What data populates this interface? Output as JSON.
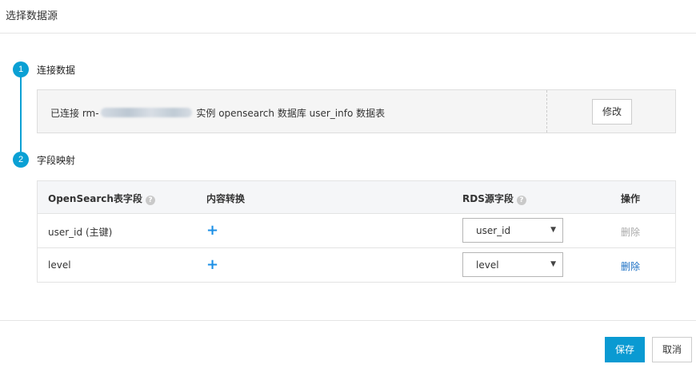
{
  "dialog": {
    "title": "选择数据源"
  },
  "steps": [
    {
      "number": "1",
      "label": "连接数据"
    },
    {
      "number": "2",
      "label": "字段映射"
    }
  ],
  "connection": {
    "text_before": "已连接 rm-",
    "text_after": " 实例 opensearch 数据库 user_info 数据表",
    "modify_label": "修改"
  },
  "mapping_table": {
    "headers": {
      "opensearch_field": "OpenSearch表字段",
      "content_transform": "内容转换",
      "rds_field": "RDS源字段",
      "actions": "操作"
    },
    "help_icon": "?",
    "rows": [
      {
        "field": "user_id (主键)",
        "transform_icon": "+",
        "rds_field": "user_id",
        "delete_label": "删除",
        "delete_enabled": false
      },
      {
        "field": "level",
        "transform_icon": "+",
        "rds_field": "level",
        "delete_label": "删除",
        "delete_enabled": true
      }
    ]
  },
  "footer": {
    "save_label": "保存",
    "cancel_label": "取消"
  },
  "colors": {
    "accent": "#0a9ad2",
    "step": "#0aa0d4",
    "link": "#1a6fc4",
    "plus": "#1b8fe6"
  }
}
